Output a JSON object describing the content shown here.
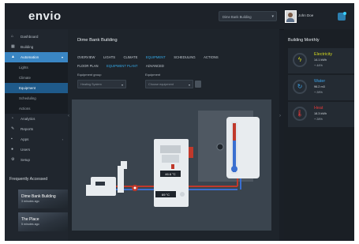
{
  "app": {
    "logo_text": "envio",
    "brand_color": "#35c0e6"
  },
  "topbar": {
    "building_select": "Dime Bank Building",
    "user_name": "John Doe",
    "icons": [
      "caret-down-icon",
      "bell-icon"
    ]
  },
  "sidebar": {
    "items": [
      {
        "label": "Dashboard",
        "icon": "home-icon"
      },
      {
        "label": "Building",
        "icon": "building-icon"
      },
      {
        "label": "Automation",
        "icon": "automation-icon",
        "active": true
      },
      {
        "label": "Analytics",
        "icon": "chart-icon"
      },
      {
        "label": "Reports",
        "icon": "pencil-icon"
      },
      {
        "label": "Apps",
        "icon": "grid-icon"
      },
      {
        "label": "Users",
        "icon": "user-icon"
      },
      {
        "label": "Setup",
        "icon": "setup-icon"
      }
    ],
    "automation_sub": [
      {
        "label": "Lights"
      },
      {
        "label": "Climate"
      },
      {
        "label": "Equipment",
        "active": true
      },
      {
        "label": "Scheduling"
      },
      {
        "label": "Actions"
      }
    ],
    "frequently_accessed_title": "Frequently Accessed",
    "frequent": [
      {
        "title": "Dime Bank Building",
        "subtitle": "3 minutes ago"
      },
      {
        "title": "The Place",
        "subtitle": "5 minutes ago"
      }
    ]
  },
  "main": {
    "title": "Dime Bank Building",
    "tabs": [
      "OVERVIEW",
      "LIGHTS",
      "CLIMATE",
      "EQUIPMENT",
      "SCHEDULING",
      "ACTIONS"
    ],
    "active_tab": "EQUIPMENT",
    "subtabs": [
      "FLOOR PLAN",
      "EQUIPMENT PLANT",
      "ADVANCED"
    ],
    "active_subtab": "EQUIPMENT PLANT",
    "group_label": "Equipment group",
    "group_value": "Heating System",
    "equipment_label": "Equipment",
    "equipment_placeholder": "Choose equipment",
    "diagram": {
      "temp_top": "46.6 °C",
      "temp_bottom": "69 °C",
      "colors": {
        "hot": "#c0392b",
        "cold": "#3a6fd0"
      }
    }
  },
  "right": {
    "title": "Building Monthly",
    "metrics": [
      {
        "name": "Electricity",
        "value": "14.1 kWh",
        "change": "+ 44%",
        "color": "#d3d81f",
        "icon": "lightning-icon"
      },
      {
        "name": "Water",
        "value": "96.2 m3",
        "change": "+ 28%",
        "color": "#3aa2e8",
        "icon": "water-icon"
      },
      {
        "name": "Heat",
        "value": "18.3 kWh",
        "change": "+ 28%",
        "color": "#e23a3a",
        "icon": "thermometer-icon"
      }
    ]
  }
}
